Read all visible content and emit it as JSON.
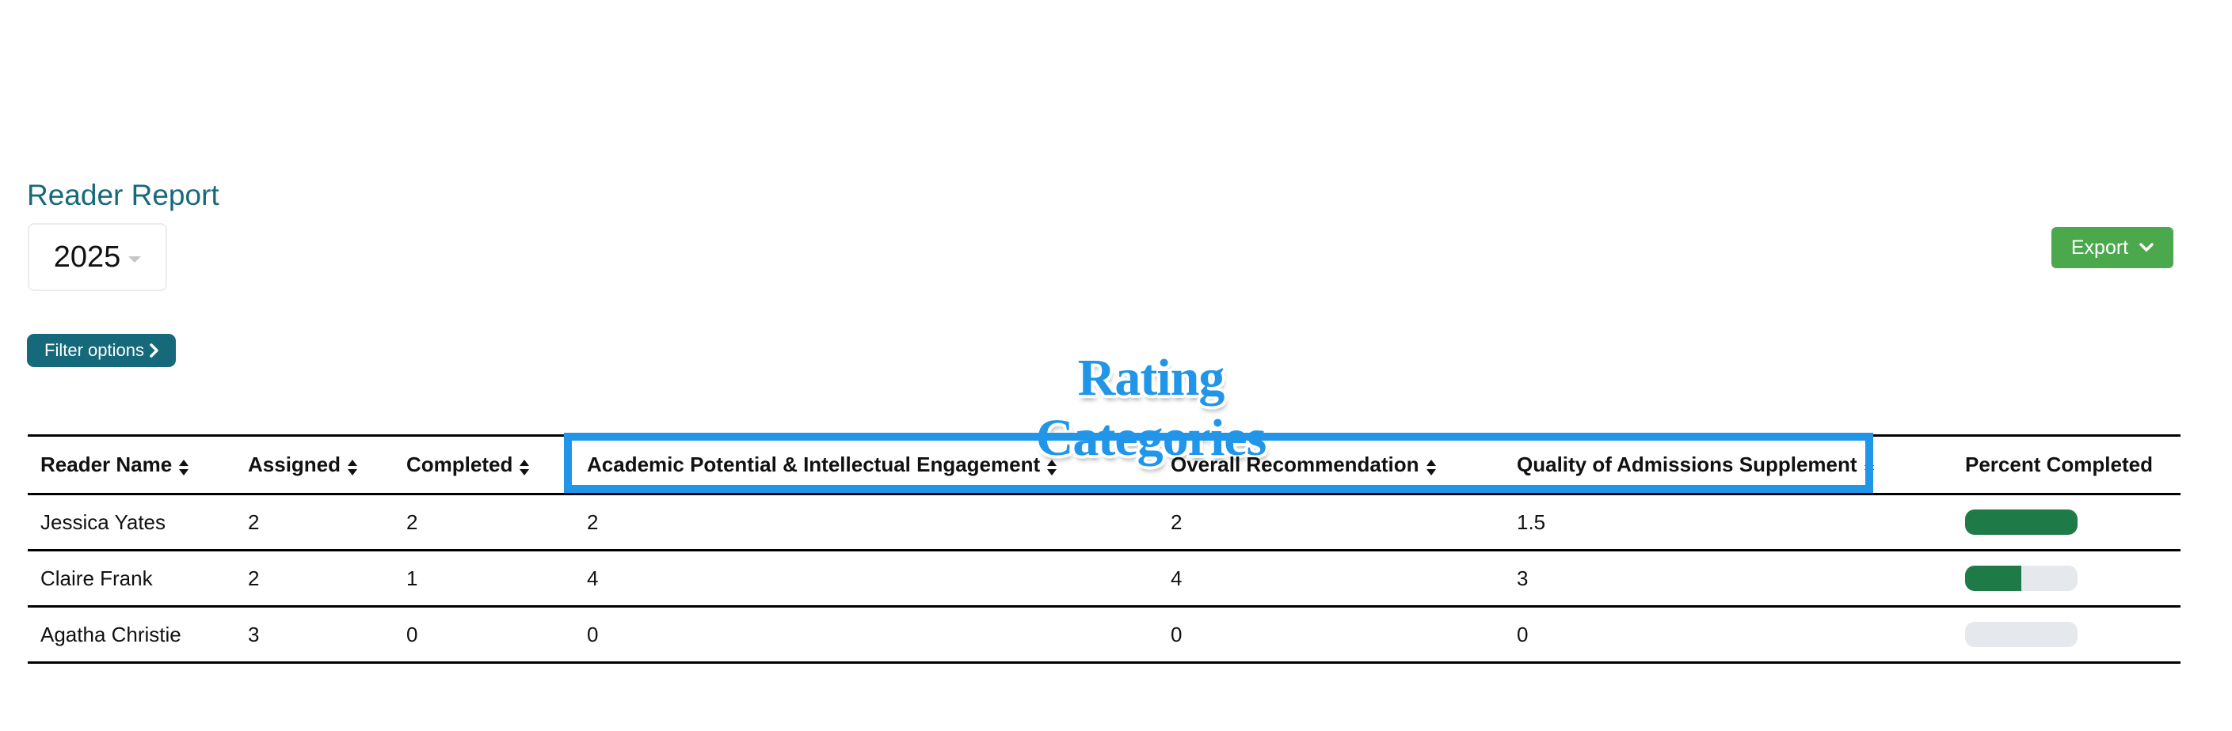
{
  "page": {
    "title": "Reader Report",
    "year_select": {
      "value": "2025"
    },
    "export_label": "Export",
    "filter_label": "Filter options"
  },
  "annotation": {
    "label": "Rating Categories",
    "color": "#2196e8"
  },
  "colors": {
    "brand": "#17697a",
    "export": "#4ca84d",
    "progress_fill": "#1e7a47",
    "progress_track": "#e5e8ec"
  },
  "table": {
    "columns": [
      {
        "label": "Reader Name",
        "sortable": true
      },
      {
        "label": "Assigned",
        "sortable": true
      },
      {
        "label": "Completed",
        "sortable": true
      },
      {
        "label": "Academic Potential & Intellectual Engagement",
        "sortable": true
      },
      {
        "label": "Overall Recommendation",
        "sortable": true
      },
      {
        "label": "Quality of Admissions Supplement",
        "sortable": true
      },
      {
        "label": "Percent Completed",
        "sortable": false
      }
    ],
    "rows": [
      {
        "name": "Jessica Yates",
        "assigned": "2",
        "completed": "2",
        "academic": "2",
        "overall": "2",
        "quality": "1.5",
        "percent_completed": 100
      },
      {
        "name": "Claire Frank",
        "assigned": "2",
        "completed": "1",
        "academic": "4",
        "overall": "4",
        "quality": "3",
        "percent_completed": 50
      },
      {
        "name": "Agatha Christie",
        "assigned": "3",
        "completed": "0",
        "academic": "0",
        "overall": "0",
        "quality": "0",
        "percent_completed": 0
      }
    ]
  }
}
